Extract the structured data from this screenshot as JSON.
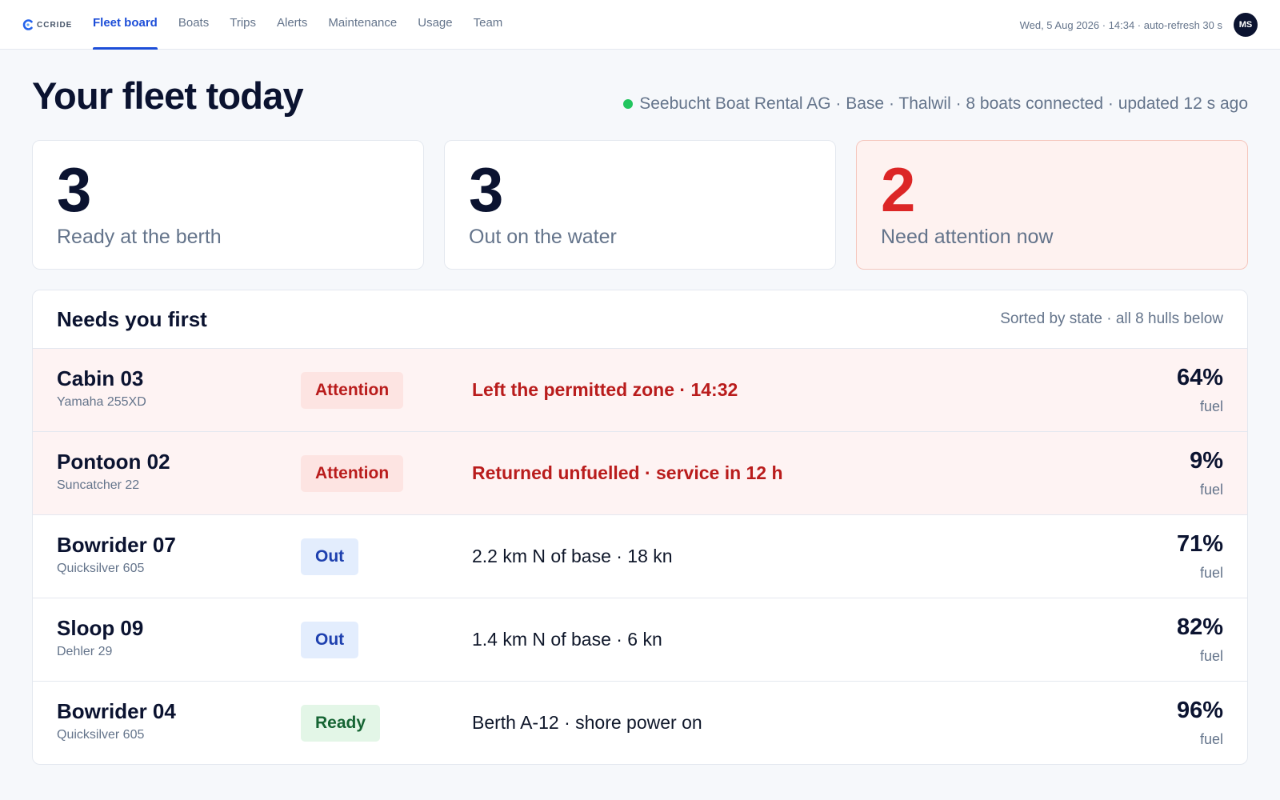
{
  "brand": {
    "name": "CCRIDE",
    "accent": "#1d4ed8"
  },
  "nav": {
    "items": [
      {
        "label": "Fleet board",
        "active": true
      },
      {
        "label": "Boats",
        "active": false
      },
      {
        "label": "Trips",
        "active": false
      },
      {
        "label": "Alerts",
        "active": false
      },
      {
        "label": "Maintenance",
        "active": false
      },
      {
        "label": "Usage",
        "active": false
      },
      {
        "label": "Team",
        "active": false
      }
    ],
    "clock": "Wed, 5 Aug 2026 · 14:34 · auto-refresh 30 s",
    "avatar": "MS"
  },
  "header": {
    "title": "Your fleet today",
    "status": "Seebucht Boat Rental AG · Base · Thalwil · 8 boats connected · updated 12 s ago",
    "status_color": "#22c55e"
  },
  "kpis": [
    {
      "value": "3",
      "label": "Ready at the berth"
    },
    {
      "value": "3",
      "label": "Out on the water"
    },
    {
      "value": "2",
      "label": "Need attention now",
      "color": "#dc2626"
    }
  ],
  "panel": {
    "title": "Needs you first",
    "note": "Sorted by state · all 8 hulls below",
    "rows": [
      {
        "name": "Cabin 03",
        "model": "Yamaha 255XD",
        "state": "Attention",
        "detail": "Left the permitted zone · 14:32",
        "fuel": "64%",
        "fuel_label": "fuel"
      },
      {
        "name": "Pontoon 02",
        "model": "Suncatcher 22",
        "state": "Attention",
        "detail": "Returned unfuelled · service in 12 h",
        "fuel": "9%",
        "fuel_label": "fuel"
      },
      {
        "name": "Bowrider 07",
        "model": "Quicksilver 605",
        "state": "Out",
        "detail": "2.2 km N of base · 18 kn",
        "fuel": "71%",
        "fuel_label": "fuel"
      },
      {
        "name": "Sloop 09",
        "model": "Dehler 29",
        "state": "Out",
        "detail": "1.4 km N of base · 6 kn",
        "fuel": "82%",
        "fuel_label": "fuel"
      },
      {
        "name": "Bowrider 04",
        "model": "Quicksilver 605",
        "state": "Ready",
        "detail": "Berth A-12 · shore power on",
        "fuel": "96%",
        "fuel_label": "fuel"
      }
    ]
  },
  "state_colors": {
    "attention": "#b91c1c",
    "out": "#1e40af",
    "ready": "#166534"
  }
}
